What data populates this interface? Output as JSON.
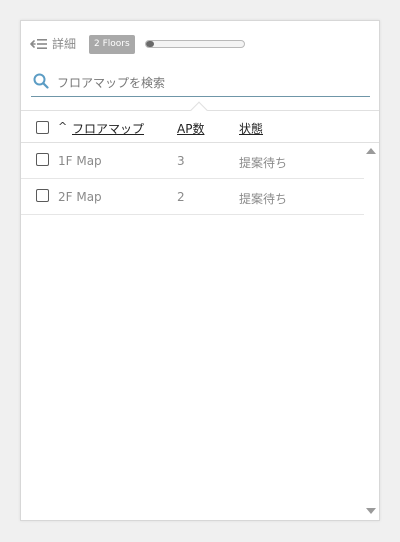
{
  "header": {
    "back_label": "詳細",
    "floors_badge": "2 Floors",
    "progress_fraction": 0.08
  },
  "search": {
    "placeholder": "フロアマップを検索"
  },
  "table": {
    "columns": {
      "name": "フロアマップ",
      "ap_count": "AP数",
      "status": "状態"
    },
    "sort_indicator": "^",
    "rows": [
      {
        "name": "1F Map",
        "ap_count": "3",
        "status": "提案待ち"
      },
      {
        "name": "2F Map",
        "ap_count": "2",
        "status": "提案待ち"
      }
    ]
  },
  "colors": {
    "search_underline": "#6f96a8",
    "badge_bg": "#a9a9a9",
    "progress_fill": "#6a6a6a"
  },
  "icons": {
    "back": "back-arrow-icon",
    "search": "search-icon",
    "scroll_up": "scroll-up-icon",
    "scroll_down": "scroll-down-icon"
  }
}
